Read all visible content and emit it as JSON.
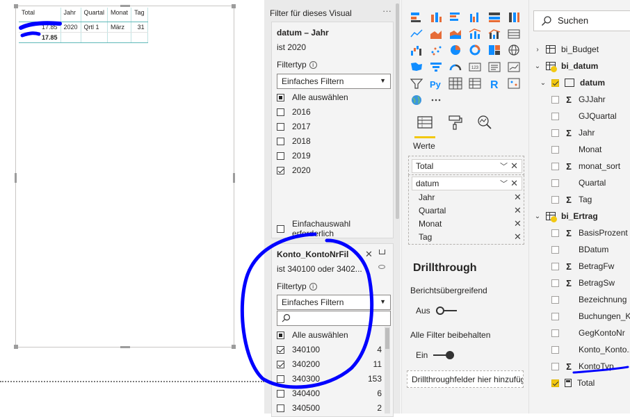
{
  "canvas": {
    "matrix": {
      "headers": [
        "Total",
        "Jahr",
        "Quartal",
        "Monat",
        "Tag"
      ],
      "row": {
        "total": "17.85",
        "jahr": "2020",
        "quartal": "Qrtl 1",
        "monat": "März",
        "tag": "31"
      },
      "total_row": {
        "total": "17.85"
      }
    }
  },
  "filter_pane": {
    "title": "Filter für dieses Visual",
    "more": "···",
    "card1": {
      "title": "datum – Jahr",
      "summary": "ist 2020",
      "filtertype_label": "Filtertyp",
      "filtertype_value": "Einfaches Filtern",
      "select_all": "Alle auswählen",
      "options": [
        {
          "label": "2016",
          "checked": false
        },
        {
          "label": "2017",
          "checked": false
        },
        {
          "label": "2018",
          "checked": false
        },
        {
          "label": "2019",
          "checked": false
        },
        {
          "label": "2020",
          "checked": true
        }
      ],
      "single_select": "Einfachauswahl erforderlich"
    },
    "card2": {
      "title": "Konto_KontoNrFil",
      "summary": "ist 340100 oder 3402...",
      "filtertype_label": "Filtertyp",
      "filtertype_value": "Einfaches Filtern",
      "select_all": "Alle auswählen",
      "options": [
        {
          "label": "340100",
          "count": "4",
          "checked": true
        },
        {
          "label": "340200",
          "count": "11",
          "checked": true
        },
        {
          "label": "340300",
          "count": "153",
          "checked": false
        },
        {
          "label": "340400",
          "count": "6",
          "checked": false
        },
        {
          "label": "340500",
          "count": "2",
          "checked": false
        }
      ]
    }
  },
  "viz_pane": {
    "values_label": "Werte",
    "well_total": "Total",
    "well_datum": "datum",
    "datum_children": [
      "Jahr",
      "Quartal",
      "Monat",
      "Tag"
    ],
    "drillthrough": {
      "title": "Drillthrough",
      "cross_report": "Berichtsübergreifend",
      "cross_state": "Aus",
      "keep_filters": "Alle Filter beibehalten",
      "keep_state": "Ein",
      "dropzone": "Drillthroughfelder hier hinzufügen"
    },
    "icons": [
      "stacked-bar",
      "stacked-column",
      "clustered-bar",
      "clustered-column",
      "100-bar",
      "100-column",
      "line",
      "area",
      "stacked-area",
      "line-column",
      "line-clustered",
      "ribbon",
      "waterfall",
      "scatter",
      "pie",
      "donut",
      "treemap",
      "map",
      "filled-map",
      "funnel",
      "gauge",
      "card",
      "multirow-card",
      "kpi",
      "slicer",
      "python",
      "table",
      "matrix",
      "r-script",
      "arcgis",
      "globe",
      "more"
    ]
  },
  "fields_pane": {
    "search_placeholder": "Suchen",
    "items": [
      {
        "level": 0,
        "kind": "table",
        "label": "bi_Budget",
        "expanded": null
      },
      {
        "level": 0,
        "kind": "table",
        "label": "bi_datum",
        "expanded": true,
        "bold": true,
        "badge": true
      },
      {
        "level": 1,
        "kind": "hierarchy",
        "label": "datum",
        "expanded": true,
        "bold": true,
        "checked": true
      },
      {
        "level": 2,
        "kind": "field",
        "sigma": true,
        "label": "GJJahr"
      },
      {
        "level": 2,
        "kind": "field",
        "sigma": false,
        "label": "GJQuartal"
      },
      {
        "level": 2,
        "kind": "field",
        "sigma": true,
        "label": "Jahr"
      },
      {
        "level": 2,
        "kind": "field",
        "sigma": false,
        "label": "Monat"
      },
      {
        "level": 2,
        "kind": "field",
        "sigma": true,
        "label": "monat_sort"
      },
      {
        "level": 2,
        "kind": "field",
        "sigma": false,
        "label": "Quartal"
      },
      {
        "level": 2,
        "kind": "field",
        "sigma": true,
        "label": "Tag"
      },
      {
        "level": 0,
        "kind": "table",
        "label": "bi_Ertrag",
        "expanded": true,
        "bold": true,
        "badge": true
      },
      {
        "level": 2,
        "kind": "field",
        "sigma": true,
        "label": "BasisProzent"
      },
      {
        "level": 2,
        "kind": "field",
        "sigma": false,
        "label": "BDatum"
      },
      {
        "level": 2,
        "kind": "field",
        "sigma": true,
        "label": "BetragFw"
      },
      {
        "level": 2,
        "kind": "field",
        "sigma": true,
        "label": "BetragSw"
      },
      {
        "level": 2,
        "kind": "field",
        "sigma": false,
        "label": "Bezeichnung"
      },
      {
        "level": 2,
        "kind": "field",
        "sigma": false,
        "label": "Buchungen_K..."
      },
      {
        "level": 2,
        "kind": "field",
        "sigma": false,
        "label": "GegKontoNr"
      },
      {
        "level": 2,
        "kind": "field",
        "sigma": false,
        "label": "Konto_Konto..."
      },
      {
        "level": 2,
        "kind": "field",
        "sigma": true,
        "label": "KontoTyp"
      },
      {
        "level": 2,
        "kind": "measure",
        "label": "Total",
        "checked": true
      }
    ]
  }
}
